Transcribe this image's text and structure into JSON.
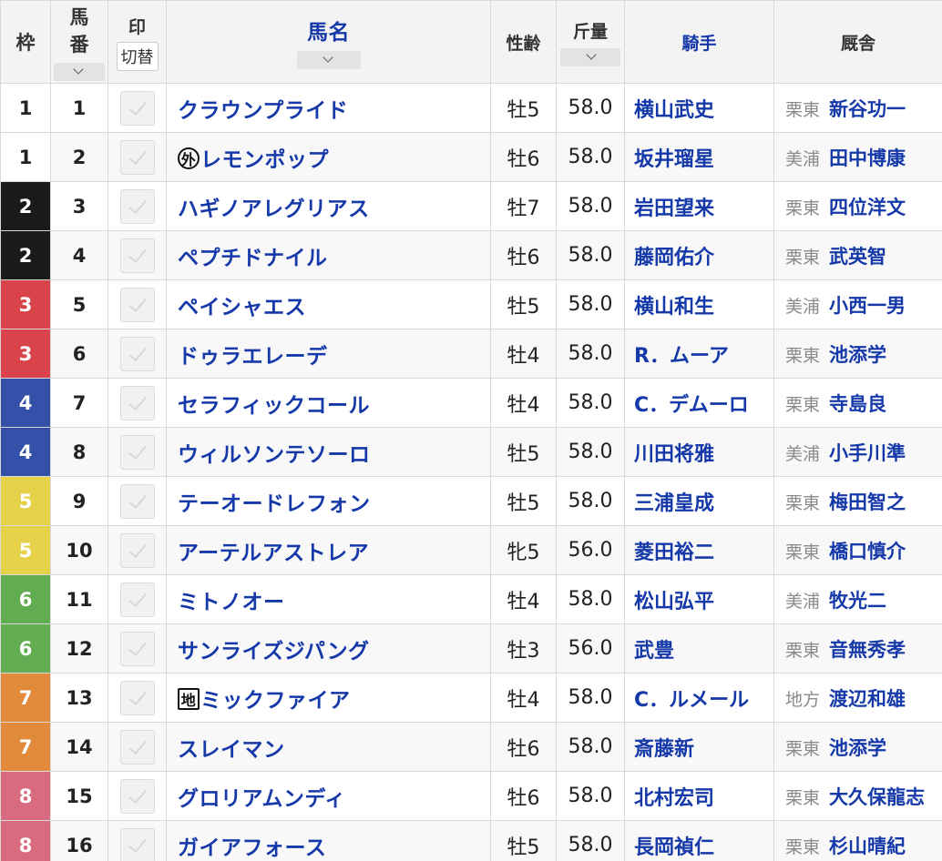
{
  "header": {
    "waku": "枠",
    "umaban_top": "馬",
    "umaban_bottom": "番",
    "mark": "印",
    "mark_toggle": "切替",
    "name": "馬名",
    "sex_age": "性齢",
    "weight": "斤量",
    "jockey": "騎手",
    "stable": "厩舎"
  },
  "colors": {
    "waku1": "#ffffff",
    "waku2": "#1a1a1a",
    "waku3": "#d9434a",
    "waku4": "#3550a8",
    "waku5": "#e5d24a",
    "waku6": "#62ac52",
    "waku7": "#e08a3a",
    "waku8": "#d96b80",
    "link": "#1539a8"
  },
  "rows": [
    {
      "waku": "1",
      "num": "1",
      "name": "クラウンプライド",
      "badge": "",
      "sex_age": "牡5",
      "weight": "58.0",
      "jockey": "横山武史",
      "area": "栗東",
      "trainer": "新谷功一"
    },
    {
      "waku": "1",
      "num": "2",
      "name": "レモンポップ",
      "badge": "外",
      "sex_age": "牡6",
      "weight": "58.0",
      "jockey": "坂井瑠星",
      "area": "美浦",
      "trainer": "田中博康"
    },
    {
      "waku": "2",
      "num": "3",
      "name": "ハギノアレグリアス",
      "badge": "",
      "sex_age": "牡7",
      "weight": "58.0",
      "jockey": "岩田望来",
      "area": "栗東",
      "trainer": "四位洋文"
    },
    {
      "waku": "2",
      "num": "4",
      "name": "ペプチドナイル",
      "badge": "",
      "sex_age": "牡6",
      "weight": "58.0",
      "jockey": "藤岡佑介",
      "area": "栗東",
      "trainer": "武英智"
    },
    {
      "waku": "3",
      "num": "5",
      "name": "ペイシャエス",
      "badge": "",
      "sex_age": "牡5",
      "weight": "58.0",
      "jockey": "横山和生",
      "area": "美浦",
      "trainer": "小西一男"
    },
    {
      "waku": "3",
      "num": "6",
      "name": "ドゥラエレーデ",
      "badge": "",
      "sex_age": "牡4",
      "weight": "58.0",
      "jockey": "R．ムーア",
      "area": "栗東",
      "trainer": "池添学"
    },
    {
      "waku": "4",
      "num": "7",
      "name": "セラフィックコール",
      "badge": "",
      "sex_age": "牡4",
      "weight": "58.0",
      "jockey": "C．デムーロ",
      "area": "栗東",
      "trainer": "寺島良"
    },
    {
      "waku": "4",
      "num": "8",
      "name": "ウィルソンテソーロ",
      "badge": "",
      "sex_age": "牡5",
      "weight": "58.0",
      "jockey": "川田将雅",
      "area": "美浦",
      "trainer": "小手川準"
    },
    {
      "waku": "5",
      "num": "9",
      "name": "テーオードレフォン",
      "badge": "",
      "sex_age": "牡5",
      "weight": "58.0",
      "jockey": "三浦皇成",
      "area": "栗東",
      "trainer": "梅田智之"
    },
    {
      "waku": "5",
      "num": "10",
      "name": "アーテルアストレア",
      "badge": "",
      "sex_age": "牝5",
      "weight": "56.0",
      "jockey": "菱田裕二",
      "area": "栗東",
      "trainer": "橋口慎介"
    },
    {
      "waku": "6",
      "num": "11",
      "name": "ミトノオー",
      "badge": "",
      "sex_age": "牡4",
      "weight": "58.0",
      "jockey": "松山弘平",
      "area": "美浦",
      "trainer": "牧光二"
    },
    {
      "waku": "6",
      "num": "12",
      "name": "サンライズジパング",
      "badge": "",
      "sex_age": "牡3",
      "weight": "56.0",
      "jockey": "武豊",
      "area": "栗東",
      "trainer": "音無秀孝"
    },
    {
      "waku": "7",
      "num": "13",
      "name": "ミックファイア",
      "badge": "地",
      "sex_age": "牡4",
      "weight": "58.0",
      "jockey": "C．ルメール",
      "area": "地方",
      "trainer": "渡辺和雄"
    },
    {
      "waku": "7",
      "num": "14",
      "name": "スレイマン",
      "badge": "",
      "sex_age": "牡6",
      "weight": "58.0",
      "jockey": "斎藤新",
      "area": "栗東",
      "trainer": "池添学"
    },
    {
      "waku": "8",
      "num": "15",
      "name": "グロリアムンディ",
      "badge": "",
      "sex_age": "牡6",
      "weight": "58.0",
      "jockey": "北村宏司",
      "area": "栗東",
      "trainer": "大久保龍志"
    },
    {
      "waku": "8",
      "num": "16",
      "name": "ガイアフォース",
      "badge": "",
      "sex_age": "牡5",
      "weight": "58.0",
      "jockey": "長岡禎仁",
      "area": "栗東",
      "trainer": "杉山晴紀"
    }
  ]
}
